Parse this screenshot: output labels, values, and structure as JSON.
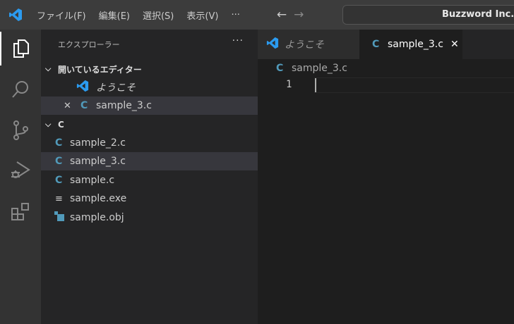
{
  "titlebar": {
    "menus": [
      "ファイル(F)",
      "編集(E)",
      "選択(S)",
      "表示(V)"
    ],
    "more": "···",
    "back": "←",
    "forward": "→",
    "search_text": "Buzzword Inc."
  },
  "activity_bar": {
    "items": [
      "explorer-icon",
      "search-icon",
      "source-control-icon",
      "run-debug-icon",
      "extensions-icon"
    ],
    "active": "explorer-icon"
  },
  "sidebar": {
    "title": "エクスプローラー",
    "more": "···",
    "open_editors": {
      "label": "開いているエディター",
      "items": [
        {
          "name": "ようこそ",
          "icon": "vscode-icon"
        },
        {
          "name": "sample_3.c",
          "icon": "c-file-icon",
          "close": "✕"
        }
      ]
    },
    "folder": {
      "label": "C",
      "files": [
        {
          "name": "sample_2.c",
          "icon": "C"
        },
        {
          "name": "sample_3.c",
          "icon": "C",
          "selected": true
        },
        {
          "name": "sample.c",
          "icon": "C"
        },
        {
          "name": "sample.exe",
          "icon": "≡"
        },
        {
          "name": "sample.obj",
          "icon": "obj"
        }
      ]
    }
  },
  "tabs": [
    {
      "label": "ようこそ",
      "active": false
    },
    {
      "label": "sample_3.c",
      "active": true,
      "close": "✕"
    }
  ],
  "editor": {
    "breadcrumb": "sample_3.c",
    "c_icon": "C",
    "line_numbers": [
      "1"
    ]
  },
  "colors": {
    "accent": "#0078d4",
    "c_icon": "#519aba"
  }
}
